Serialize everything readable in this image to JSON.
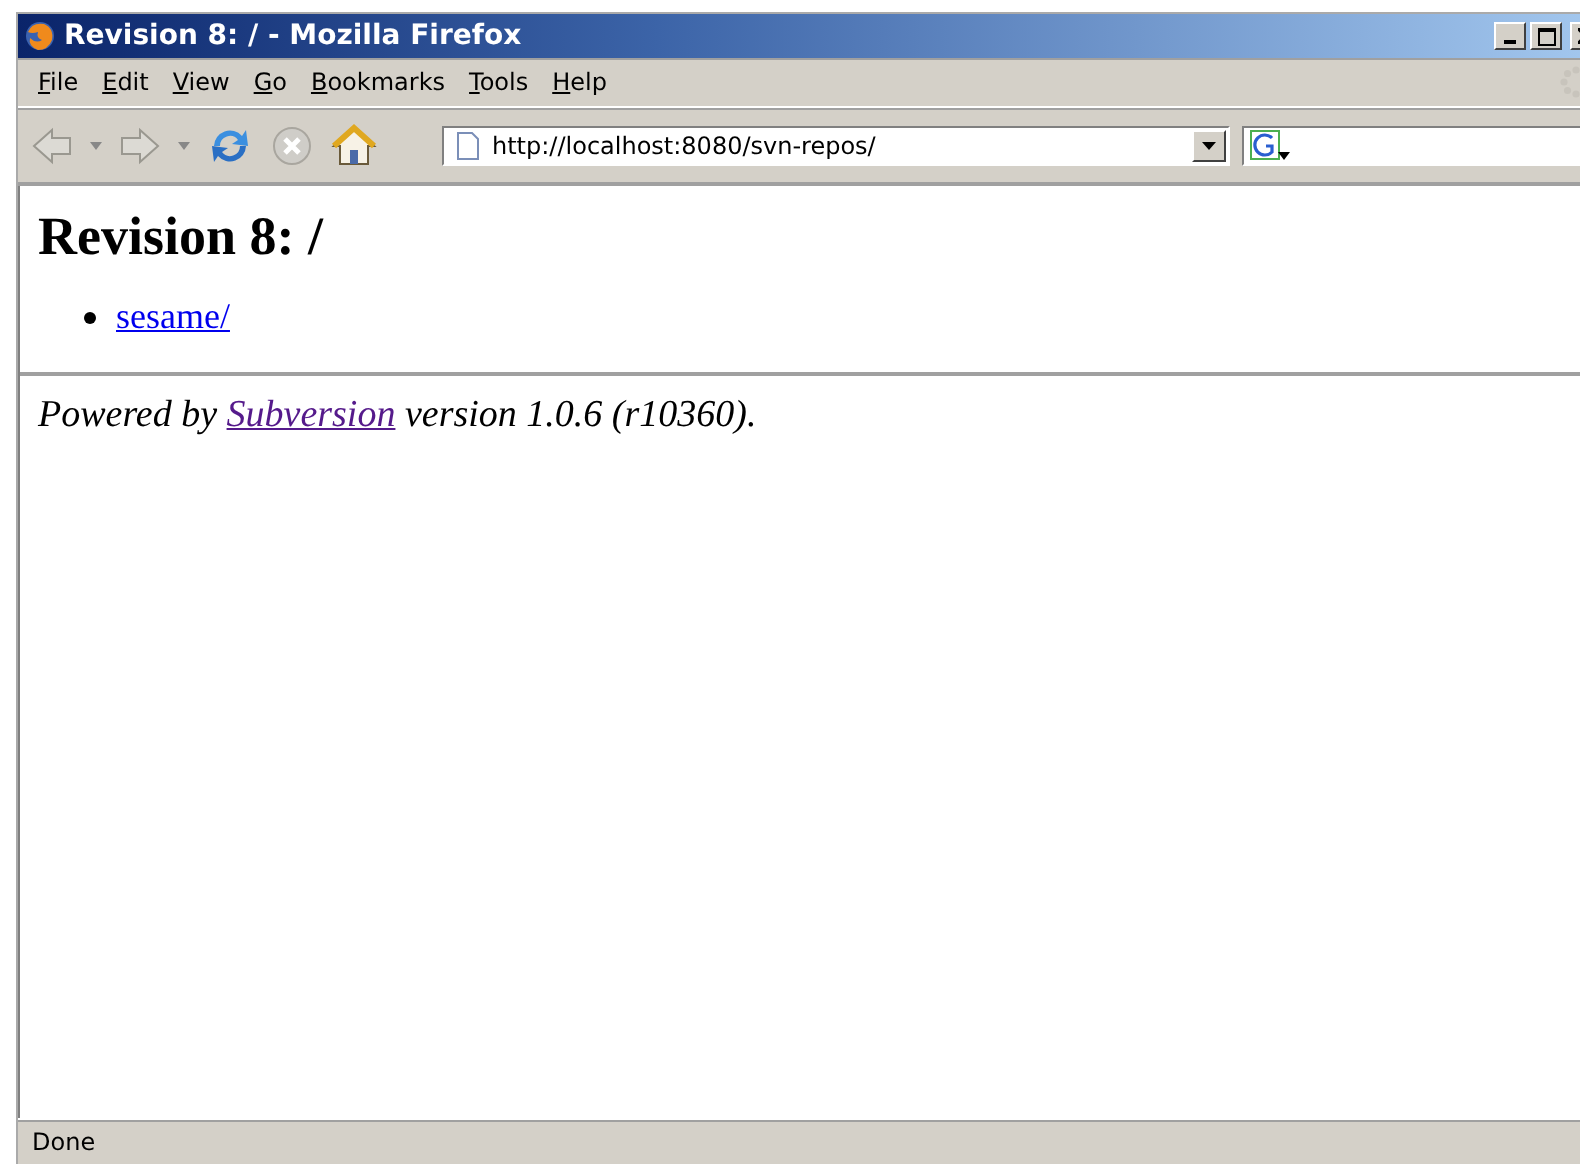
{
  "window": {
    "title": "Revision 8: / - Mozilla Firefox"
  },
  "menu": [
    "File",
    "Edit",
    "View",
    "Go",
    "Bookmarks",
    "Tools",
    "Help"
  ],
  "address_bar": {
    "value": "http://localhost:8080/svn-repos/"
  },
  "page": {
    "heading": "Revision 8: /",
    "items": [
      {
        "text": "sesame/",
        "visited": false
      }
    ],
    "footer": {
      "before": "Powered by ",
      "link": {
        "text": "Subversion",
        "visited": true
      },
      "after": " version 1.0.6 (r10360)."
    }
  },
  "status_bar": {
    "text": "Done"
  }
}
